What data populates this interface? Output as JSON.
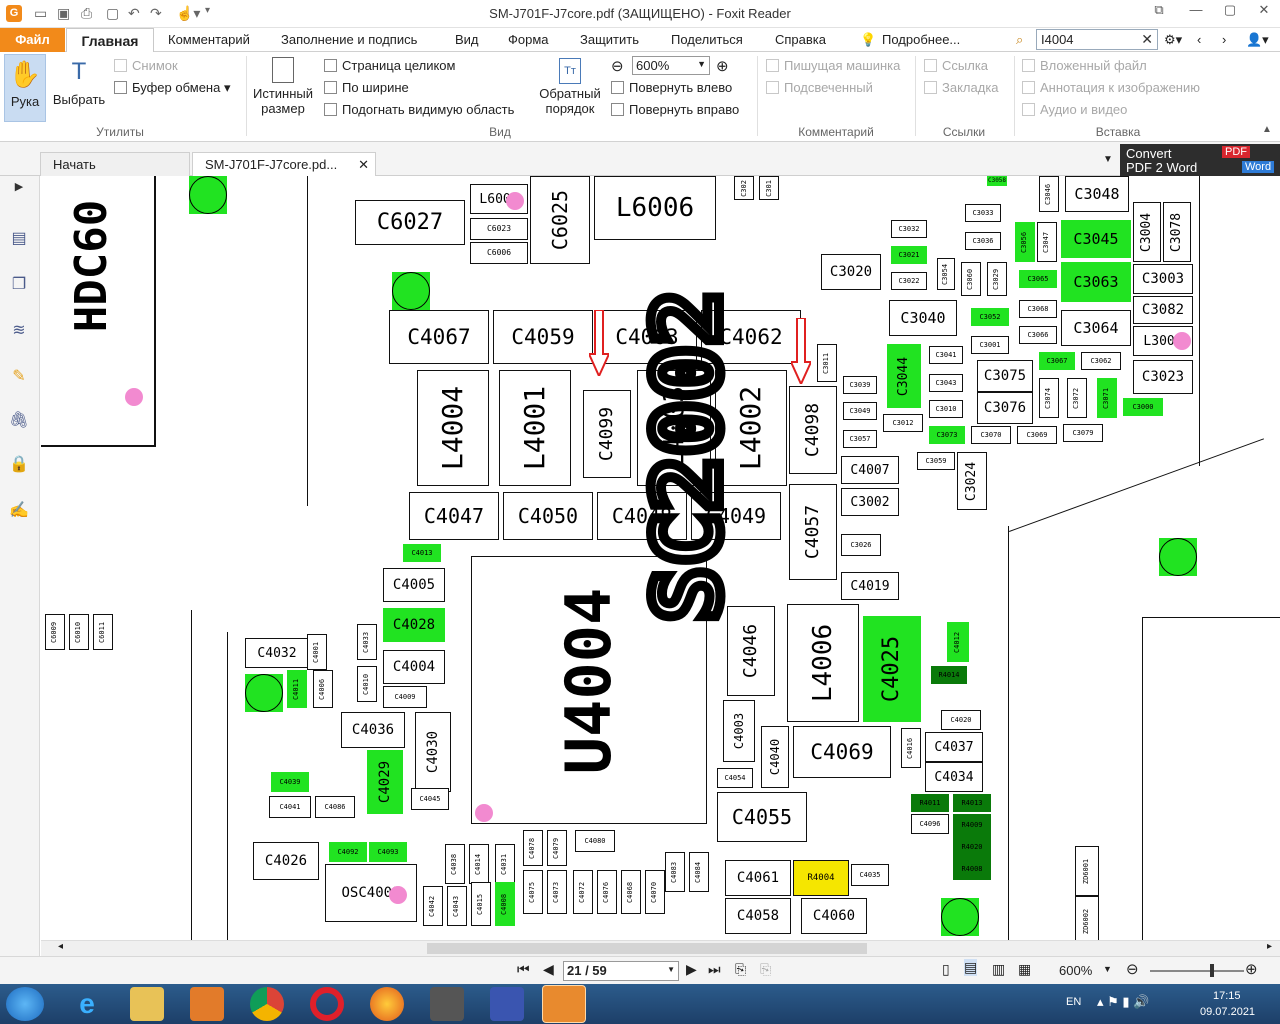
{
  "window": {
    "title": "SM-J701F-J7core.pdf (ЗАЩИЩЕНО) - Foxit Reader"
  },
  "menu": {
    "file": "Файл",
    "home": "Главная",
    "items": [
      "Комментарий",
      "Заполнение и подпись",
      "Вид",
      "Форма",
      "Защитить",
      "Поделиться",
      "Справка"
    ],
    "tell_me": "Подробнее...",
    "search_value": "I4004"
  },
  "ribbon": {
    "hand": "Рука",
    "select": "Выбрать",
    "snapshot": "Снимок",
    "clipboard": "Буфер обмена",
    "group_utils": "Утилиты",
    "actual_size_1": "Истинный",
    "actual_size_2": "размер",
    "fit_page": "Страница целиком",
    "fit_width": "По ширине",
    "fit_visible": "Подогнать видимую область",
    "reverse_1": "Обратный",
    "reverse_2": "порядок",
    "zoom": "600%",
    "rotate_left": "Повернуть влево",
    "rotate_right": "Повернуть вправо",
    "group_view": "Вид",
    "typewriter": "Пишущая машинка",
    "highlight": "Подсвеченный",
    "group_comment": "Комментарий",
    "link": "Ссылка",
    "bookmark": "Закладка",
    "group_links": "Ссылки",
    "attachment": "Вложенный файл",
    "image_annot": "Аннотация к изображению",
    "audio_video": "Аудио и видео",
    "group_insert": "Вставка"
  },
  "tabs": {
    "start": "Начать",
    "doc": "SM-J701F-J7core.pd...",
    "convert_1": "Convert",
    "convert_2": "PDF 2 Word",
    "badge_pdf": "PDF",
    "badge_word": "Word"
  },
  "status": {
    "page": "21 / 59",
    "zoom": "600%"
  },
  "taskbar": {
    "lang": "EN",
    "time": "17:15",
    "date": "09.07.2021"
  },
  "board": {
    "big": [
      "HDC60",
      "SC2002",
      "U4004"
    ],
    "comps": [
      "C6027",
      "L6001",
      "C6023",
      "C6006",
      "C6025",
      "L6006",
      "C302",
      "C301",
      "C3048",
      "C3046",
      "C3033",
      "C3032",
      "C3036",
      "C3056",
      "C3047",
      "C3045",
      "C3004",
      "C3078",
      "C3020",
      "C3021",
      "C3022",
      "C3054",
      "C3060",
      "C3029",
      "C3065",
      "C3063",
      "C3003",
      "C3068",
      "C3082",
      "C3040",
      "C3052",
      "C3001",
      "C3066",
      "C3064",
      "L3001",
      "C4067",
      "C4059",
      "C4063",
      "C4062",
      "C3011",
      "C3044",
      "C3041",
      "C3067",
      "C3062",
      "C3075",
      "C3074",
      "C3072",
      "C3071",
      "C3023",
      "C3039",
      "C3043",
      "C3010",
      "C3076",
      "C3000",
      "C3049",
      "C3012",
      "C3073",
      "C3070",
      "C3069",
      "C3079",
      "C3057",
      "C3059",
      "C3024",
      "L4004",
      "L4001",
      "C4099",
      "L4003",
      "L4002",
      "C4098",
      "C4007",
      "C3002",
      "C4047",
      "C4050",
      "C4048",
      "C4049",
      "C4057",
      "C4013",
      "C3026",
      "C4019",
      "C4005",
      "C4028",
      "C4046",
      "L4006",
      "C4025",
      "C4012",
      "C4032",
      "C4001",
      "C4033",
      "C4004",
      "C4011",
      "C4006",
      "C4010",
      "C4009",
      "R4014",
      "C4036",
      "C4030",
      "C4003",
      "C4040",
      "C4069",
      "C4016",
      "C4020",
      "C4037",
      "C4039",
      "C4029",
      "C4054",
      "C4034",
      "C4041",
      "C4086",
      "C4045",
      "C4055",
      "R4011",
      "R4013",
      "C4096",
      "R4009",
      "C4026",
      "C4092",
      "C4093",
      "C4078",
      "C4079",
      "C4080",
      "R4020",
      "OSC4001",
      "C4038",
      "C4014",
      "C4031",
      "C4083",
      "C4084",
      "C4061",
      "R4004",
      "C4035",
      "R4008",
      "ZD6001",
      "C4042",
      "C4043",
      "C4015",
      "C4008",
      "C4075",
      "C4073",
      "C4072",
      "C4076",
      "C4068",
      "C4070",
      "C4058",
      "C4060",
      "ZD6002",
      "C6009",
      "C6010",
      "C6011",
      "C3058"
    ]
  },
  "colors": {
    "accent": "#f28a1a",
    "green": "#21e321",
    "dark_green": "#0a7a0a",
    "yellow": "#f5e600",
    "pink": "#f28ad0",
    "arrow_red": "#e02020"
  }
}
